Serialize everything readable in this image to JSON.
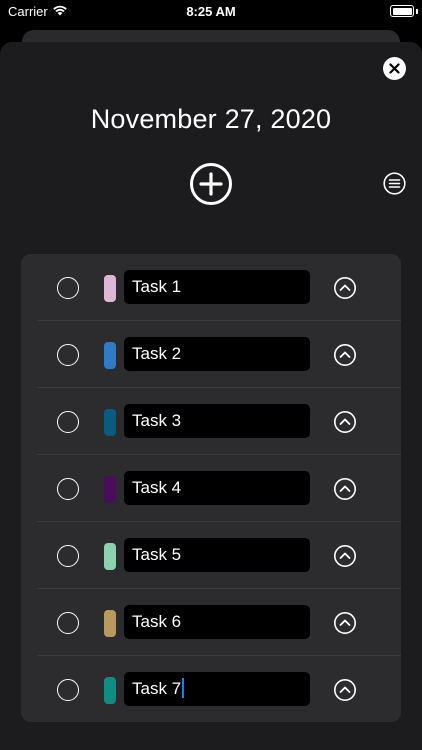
{
  "status_bar": {
    "carrier": "Carrier",
    "time": "8:25 AM"
  },
  "sheet": {
    "date_title": "November 27, 2020"
  },
  "tasks": [
    {
      "label": "Task 1",
      "color": "#dcb8d6",
      "completed": false
    },
    {
      "label": "Task 2",
      "color": "#2f7bc6",
      "completed": false
    },
    {
      "label": "Task 3",
      "color": "#0a5b82",
      "completed": false
    },
    {
      "label": "Task 4",
      "color": "#4a0d5c",
      "completed": false
    },
    {
      "label": "Task 5",
      "color": "#8ed1b1",
      "completed": false
    },
    {
      "label": "Task 6",
      "color": "#b89a5e",
      "completed": false
    },
    {
      "label": "Task 7",
      "color": "#0e8d83",
      "completed": false,
      "editing": true
    }
  ],
  "colors": {
    "background": "#000000",
    "sheet": "#1c1c1e",
    "list": "#2c2c2e",
    "caret": "#0a84ff"
  },
  "icons": {
    "close": "close-icon",
    "add": "plus-circle-icon",
    "list": "list-icon",
    "move_up": "chevron-up-circle-icon",
    "wifi": "wifi-icon",
    "battery": "battery-icon"
  }
}
